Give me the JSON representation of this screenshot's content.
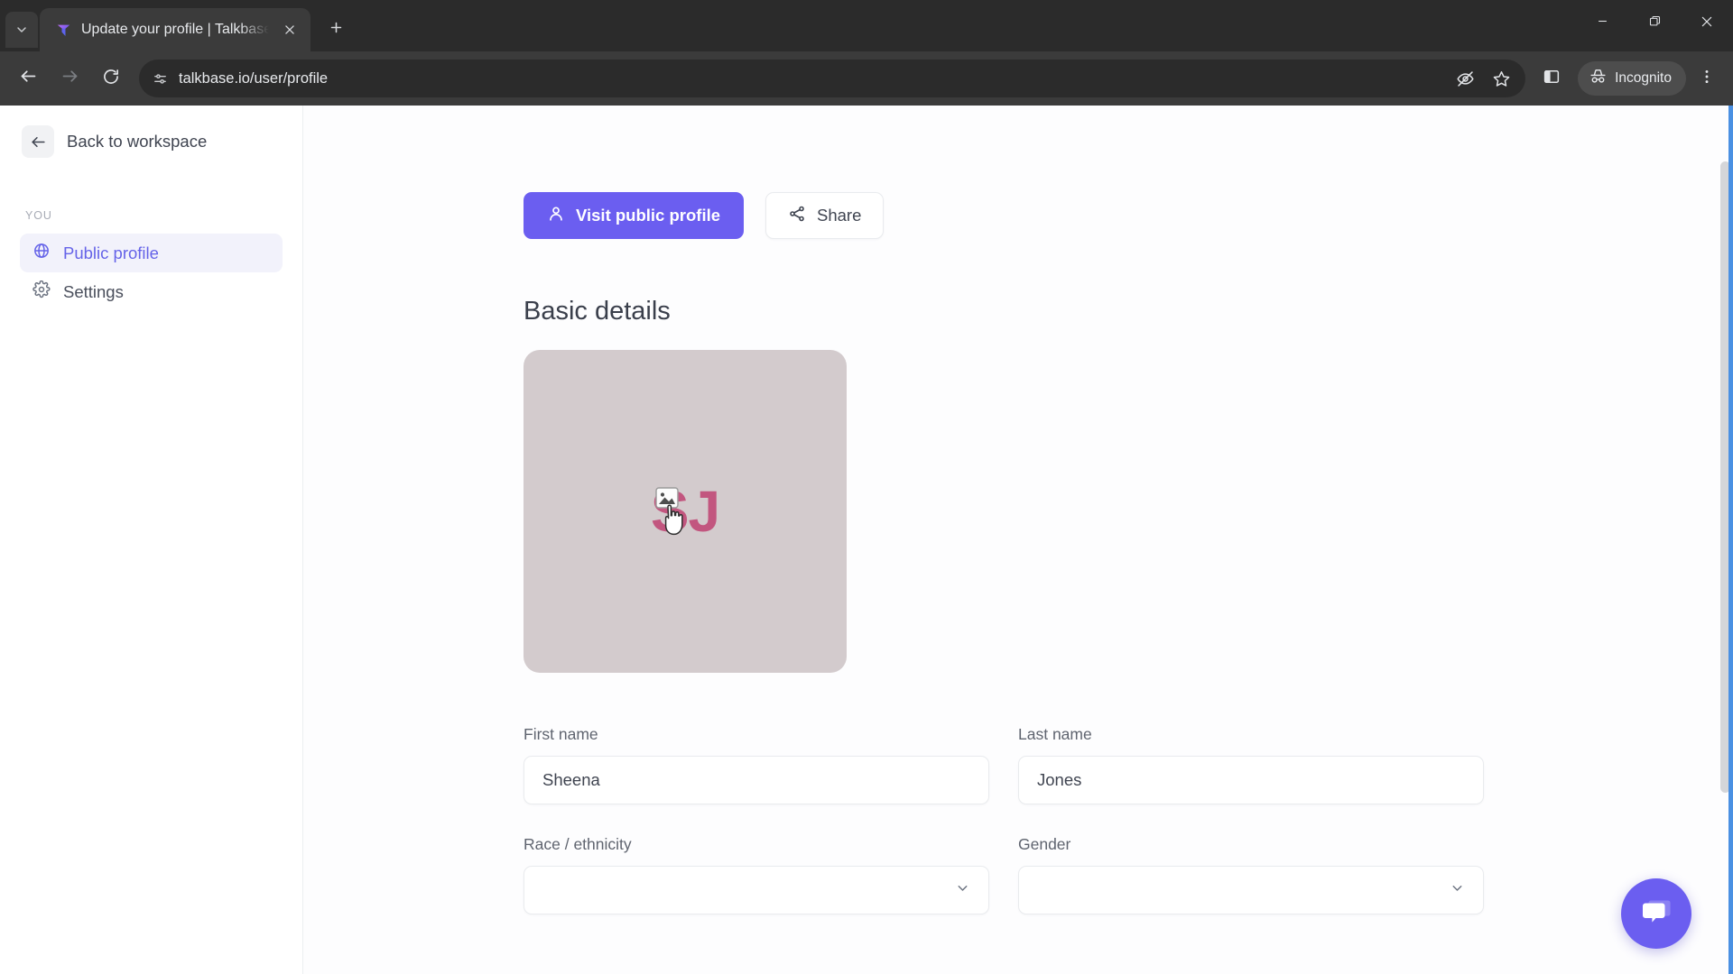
{
  "browser": {
    "tab": {
      "title": "Update your profile | Talkbase.io",
      "favicon_icon": "talkbase-logo-icon",
      "close_icon": "close-icon"
    },
    "tab_list_icon": "chevron-down-icon",
    "new_tab_icon": "plus-icon",
    "window_controls": {
      "minimize_icon": "minimize-icon",
      "maximize_icon": "restore-icon",
      "close_icon": "close-icon"
    },
    "toolbar": {
      "back_icon": "arrow-left-icon",
      "forward_icon": "arrow-right-icon",
      "reload_icon": "reload-icon",
      "site_info_icon": "page-settings-icon",
      "url": "talkbase.io/user/profile",
      "tracking_icon": "eye-off-icon",
      "bookmark_icon": "star-icon",
      "side_panel_icon": "side-panel-icon",
      "incognito_icon": "incognito-hat-icon",
      "incognito_label": "Incognito",
      "menu_icon": "three-dot-menu-icon"
    }
  },
  "sidebar": {
    "back": {
      "icon": "arrow-left-icon",
      "label": "Back to workspace"
    },
    "section_label": "YOU",
    "items": [
      {
        "label": "Public profile",
        "icon": "globe-icon",
        "active": true
      },
      {
        "label": "Settings",
        "icon": "gear-icon",
        "active": false
      }
    ]
  },
  "main": {
    "actions": {
      "visit_profile_label": "Visit public profile",
      "visit_profile_icon": "person-icon",
      "share_label": "Share",
      "share_icon": "share-nodes-icon"
    },
    "section_title": "Basic details",
    "avatar": {
      "initials": "SJ",
      "upload_icon": "image-upload-icon",
      "background_color": "#d3cbcd",
      "text_color": "#c2567f"
    },
    "fields": [
      {
        "label": "First name",
        "type": "text",
        "value": "Sheena",
        "placeholder": ""
      },
      {
        "label": "Last name",
        "type": "text",
        "value": "Jones",
        "placeholder": ""
      },
      {
        "label": "Race / ethnicity",
        "type": "select",
        "value": "",
        "placeholder": ""
      },
      {
        "label": "Gender",
        "type": "select",
        "value": "",
        "placeholder": ""
      }
    ],
    "chat_widget_icon": "chat-bubbles-icon"
  },
  "colors": {
    "accent": "#6b5ef0",
    "accent_light": "#f2f2fb",
    "nav_active_text": "#6563e8",
    "chrome_dark": "#3b3b3b",
    "chrome_darker": "#2b2b2b"
  }
}
